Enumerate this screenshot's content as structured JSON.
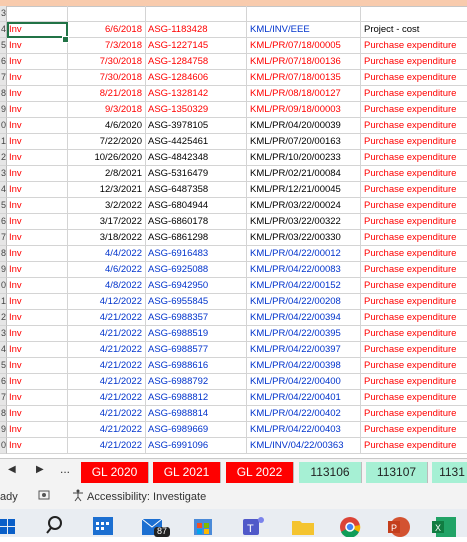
{
  "rows": [
    {
      "num": "3",
      "a": "",
      "b": "",
      "c": "",
      "d": "",
      "e": "",
      "color": "blk"
    },
    {
      "num": "4",
      "a": "Inv",
      "b": "6/6/2018",
      "c": "ASG-1183428",
      "d": "KML/INV/EEE",
      "e": "Project - cost",
      "color": "red",
      "dcolor": "blu",
      "ecolor": "blk"
    },
    {
      "num": "5",
      "a": "Inv",
      "b": "7/3/2018",
      "c": "ASG-1227145",
      "d": "KML/PR/07/18/00005",
      "e": "Purchase expenditure",
      "color": "red"
    },
    {
      "num": "6",
      "a": "Inv",
      "b": "7/30/2018",
      "c": "ASG-1284758",
      "d": "KML/PR/07/18/00136",
      "e": "Purchase expenditure",
      "color": "red"
    },
    {
      "num": "7",
      "a": "Inv",
      "b": "7/30/2018",
      "c": "ASG-1284606",
      "d": "KML/PR/07/18/00135",
      "e": "Purchase expenditure",
      "color": "red"
    },
    {
      "num": "8",
      "a": "Inv",
      "b": "8/21/2018",
      "c": "ASG-1328142",
      "d": "KML/PR/08/18/00127",
      "e": "Purchase expenditure",
      "color": "red"
    },
    {
      "num": "9",
      "a": "Inv",
      "b": "9/3/2018",
      "c": "ASG-1350329",
      "d": "KML/PR/09/18/00003",
      "e": "Purchase expenditure",
      "color": "red"
    },
    {
      "num": "0",
      "a": "Inv",
      "b": "4/6/2020",
      "c": "ASG-3978105",
      "d": "KML/PR/04/20/00039",
      "e": "Purchase expenditure",
      "color": "blk",
      "acolor": "red",
      "ecolor": "red"
    },
    {
      "num": "1",
      "a": "Inv",
      "b": "7/22/2020",
      "c": "ASG-4425461",
      "d": "KML/PR/07/20/00163",
      "e": "Purchase expenditure",
      "color": "blk",
      "acolor": "red",
      "ecolor": "red"
    },
    {
      "num": "2",
      "a": "Inv",
      "b": "10/26/2020",
      "c": "ASG-4842348",
      "d": "KML/PR/10/20/00233",
      "e": "Purchase expenditure",
      "color": "blk",
      "acolor": "red",
      "ecolor": "red"
    },
    {
      "num": "3",
      "a": "Inv",
      "b": "2/8/2021",
      "c": "ASG-5316479",
      "d": "KML/PR/02/21/00084",
      "e": "Purchase expenditure",
      "color": "blk",
      "acolor": "red",
      "ecolor": "red"
    },
    {
      "num": "4",
      "a": "Inv",
      "b": "12/3/2021",
      "c": "ASG-6487358",
      "d": "KML/PR/12/21/00045",
      "e": "Purchase expenditure",
      "color": "blk",
      "acolor": "red",
      "ecolor": "red"
    },
    {
      "num": "5",
      "a": "Inv",
      "b": "3/2/2022",
      "c": "ASG-6804944",
      "d": "KML/PR/03/22/00024",
      "e": "Purchase expenditure",
      "color": "blk",
      "acolor": "red",
      "ecolor": "red"
    },
    {
      "num": "6",
      "a": "Inv",
      "b": "3/17/2022",
      "c": "ASG-6860178",
      "d": "KML/PR/03/22/00322",
      "e": "Purchase expenditure",
      "color": "blk",
      "acolor": "red",
      "ecolor": "red"
    },
    {
      "num": "7",
      "a": "Inv",
      "b": "3/18/2022",
      "c": "ASG-6861298",
      "d": "KML/PR/03/22/00330",
      "e": "Purchase expenditure",
      "color": "blk",
      "acolor": "red",
      "ecolor": "red"
    },
    {
      "num": "8",
      "a": "Inv",
      "b": "4/4/2022",
      "c": "ASG-6916483",
      "d": "KML/PR/04/22/00012",
      "e": "Purchase expenditure",
      "color": "blu",
      "acolor": "red",
      "ecolor": "red"
    },
    {
      "num": "9",
      "a": "Inv",
      "b": "4/6/2022",
      "c": "ASG-6925088",
      "d": "KML/PR/04/22/00083",
      "e": "Purchase expenditure",
      "color": "blu",
      "acolor": "red",
      "ecolor": "red"
    },
    {
      "num": "0",
      "a": "Inv",
      "b": "4/8/2022",
      "c": "ASG-6942950",
      "d": "KML/PR/04/22/00152",
      "e": "Purchase expenditure",
      "color": "blu",
      "acolor": "red",
      "ecolor": "red"
    },
    {
      "num": "1",
      "a": "Inv",
      "b": "4/12/2022",
      "c": "ASG-6955845",
      "d": "KML/PR/04/22/00208",
      "e": "Purchase expenditure",
      "color": "blu",
      "acolor": "red",
      "ecolor": "red"
    },
    {
      "num": "2",
      "a": "Inv",
      "b": "4/21/2022",
      "c": "ASG-6988357",
      "d": "KML/PR/04/22/00394",
      "e": "Purchase expenditure",
      "color": "blu",
      "acolor": "red",
      "ecolor": "red"
    },
    {
      "num": "3",
      "a": "Inv",
      "b": "4/21/2022",
      "c": "ASG-6988519",
      "d": "KML/PR/04/22/00395",
      "e": "Purchase expenditure",
      "color": "blu",
      "acolor": "red",
      "ecolor": "red"
    },
    {
      "num": "4",
      "a": "Inv",
      "b": "4/21/2022",
      "c": "ASG-6988577",
      "d": "KML/PR/04/22/00397",
      "e": "Purchase expenditure",
      "color": "blu",
      "acolor": "red",
      "ecolor": "red"
    },
    {
      "num": "5",
      "a": "Inv",
      "b": "4/21/2022",
      "c": "ASG-6988616",
      "d": "KML/PR/04/22/00398",
      "e": "Purchase expenditure",
      "color": "blu",
      "acolor": "red",
      "ecolor": "red"
    },
    {
      "num": "6",
      "a": "Inv",
      "b": "4/21/2022",
      "c": "ASG-6988792",
      "d": "KML/PR/04/22/00400",
      "e": "Purchase expenditure",
      "color": "blu",
      "acolor": "red",
      "ecolor": "red"
    },
    {
      "num": "7",
      "a": "Inv",
      "b": "4/21/2022",
      "c": "ASG-6988812",
      "d": "KML/PR/04/22/00401",
      "e": "Purchase expenditure",
      "color": "blu",
      "acolor": "red",
      "ecolor": "red"
    },
    {
      "num": "8",
      "a": "Inv",
      "b": "4/21/2022",
      "c": "ASG-6988814",
      "d": "KML/PR/04/22/00402",
      "e": "Purchase expenditure",
      "color": "blu",
      "acolor": "red",
      "ecolor": "red"
    },
    {
      "num": "9",
      "a": "Inv",
      "b": "4/21/2022",
      "c": "ASG-6989669",
      "d": "KML/PR/04/22/00403",
      "e": "Purchase expenditure",
      "color": "blu",
      "acolor": "red",
      "ecolor": "red"
    },
    {
      "num": "0",
      "a": "Inv",
      "b": "4/21/2022",
      "c": "ASG-6991096",
      "d": "KML/INV/04/22/00363",
      "e": "Purchase expenditure",
      "color": "blu",
      "acolor": "red",
      "ecolor": "red"
    }
  ],
  "tabs": {
    "nav_prev": "◀",
    "nav_next": "▶",
    "more": "...",
    "sheets": [
      {
        "label": "GL 2020",
        "style": "r"
      },
      {
        "label": "GL 2021",
        "style": "r"
      },
      {
        "label": "GL 2022",
        "style": "r"
      },
      {
        "label": "113106",
        "style": "g"
      },
      {
        "label": "113107",
        "style": "g"
      },
      {
        "label": "1131",
        "style": "g"
      }
    ]
  },
  "status": {
    "ready": "ady",
    "accessibility": "Accessibility: Investigate"
  },
  "taskbar": {
    "mail_badge": "87",
    "icons": [
      "windows-icon",
      "search-icon",
      "calendar-icon",
      "mail-icon",
      "store-icon",
      "teams-icon",
      "file-explorer-icon",
      "chrome-icon",
      "powerpoint-icon",
      "excel-icon"
    ]
  },
  "colors": {
    "red": "#ff0000",
    "blue": "#0033cc",
    "accent": "#217346",
    "tab_red": "#ff0000",
    "tab_green": "#a6f0d4"
  }
}
